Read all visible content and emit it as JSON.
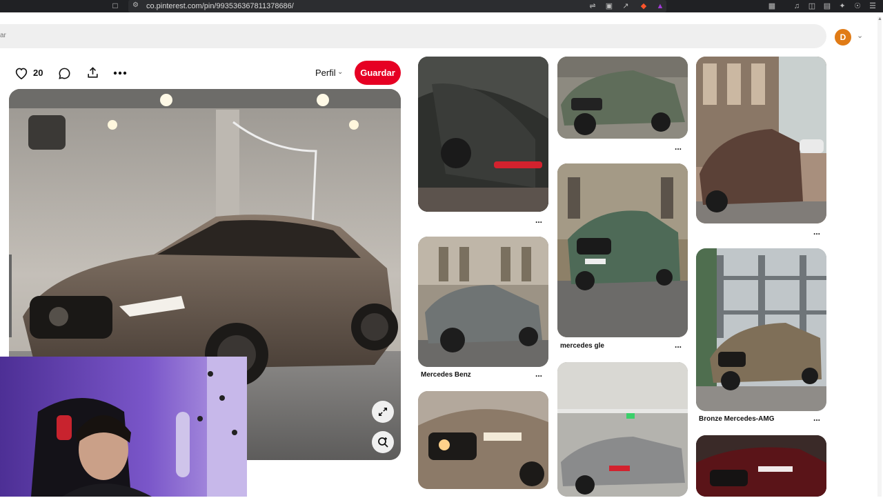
{
  "browser": {
    "url": "co.pinterest.com/pin/993536367811378686/",
    "site_icon": "site-info-icon",
    "bookmark_icon": "bookmark-icon",
    "extensions": [
      "translate-icon",
      "cast-icon",
      "share-icon",
      "brave-shield-icon",
      "rewards-icon",
      "tab-search-icon",
      "music-icon",
      "sidebar-icon",
      "wallet-icon",
      "extensions-icon",
      "vpn-icon",
      "menu-icon"
    ]
  },
  "header": {
    "search_placeholder": "ar",
    "avatar_letter": "D"
  },
  "pin": {
    "like_count": "20",
    "profile_label": "Perfil",
    "save_label": "Guardar"
  },
  "grid": {
    "titles": {
      "mercedes_benz": "Mercedes Benz",
      "mercedes_gle": "mercedes gle",
      "bronze_amg": "Bronze Mercedes-AMG"
    },
    "more_label": "..."
  },
  "colors": {
    "save_red": "#e60023",
    "avatar_orange": "#e07b16",
    "search_bg": "#efefef"
  }
}
